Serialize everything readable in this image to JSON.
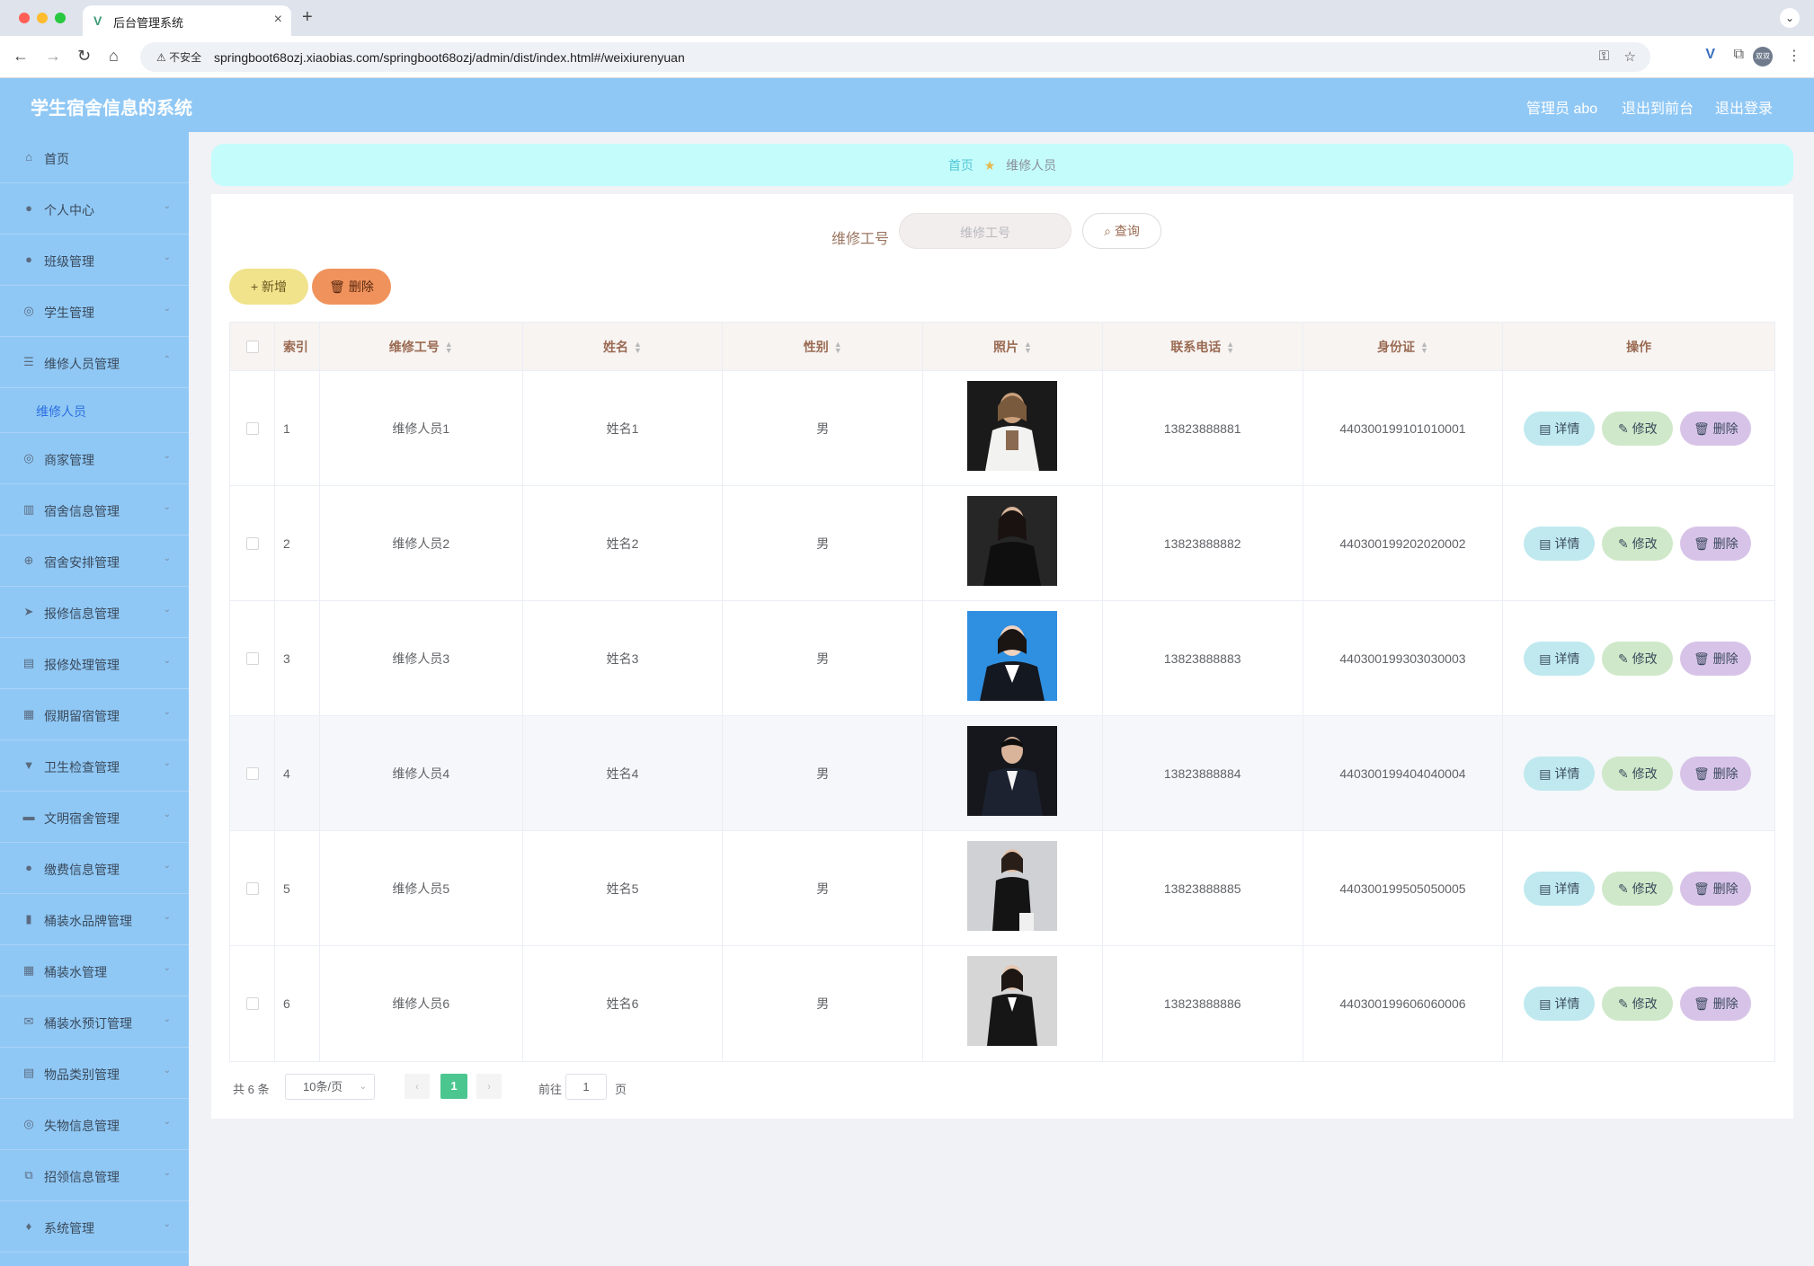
{
  "browser": {
    "tab_title": "后台管理系统",
    "security_label": "不安全",
    "url": "springboot68ozj.xiaobias.com/springboot68ozj/admin/dist/index.html#/weixiurenyuan",
    "profile_label": "双双"
  },
  "header": {
    "title": "学生宿舍信息的系统",
    "admin_label": "管理员 abo",
    "to_front": "退出到前台",
    "logout": "退出登录"
  },
  "sidebar": {
    "items": [
      {
        "label": "首页",
        "icon": "home-icon"
      },
      {
        "label": "个人中心",
        "icon": "user-icon"
      },
      {
        "label": "班级管理",
        "icon": "user-icon"
      },
      {
        "label": "学生管理",
        "icon": "compass-icon"
      },
      {
        "label": "维修人员管理",
        "icon": "sliders-icon"
      },
      {
        "label": "商家管理",
        "icon": "shop-icon"
      },
      {
        "label": "宿舍信息管理",
        "icon": "building-icon"
      },
      {
        "label": "宿舍安排管理",
        "icon": "target-icon"
      },
      {
        "label": "报修信息管理",
        "icon": "send-icon"
      },
      {
        "label": "报修处理管理",
        "icon": "clipboard-icon"
      },
      {
        "label": "假期留宿管理",
        "icon": "grid-icon"
      },
      {
        "label": "卫生检查管理",
        "icon": "brush-icon"
      },
      {
        "label": "文明宿舍管理",
        "icon": "monitor-icon"
      },
      {
        "label": "缴费信息管理",
        "icon": "user-icon"
      },
      {
        "label": "桶装水品牌管理",
        "icon": "chart-icon"
      },
      {
        "label": "桶装水管理",
        "icon": "grid-icon"
      },
      {
        "label": "桶装水预订管理",
        "icon": "mail-icon"
      },
      {
        "label": "物品类别管理",
        "icon": "clipboard-icon"
      },
      {
        "label": "失物信息管理",
        "icon": "compass-icon"
      },
      {
        "label": "招领信息管理",
        "icon": "copy-icon"
      },
      {
        "label": "系统管理",
        "icon": "mic-icon"
      }
    ],
    "sub_item": "维修人员"
  },
  "breadcrumb": {
    "home": "首页",
    "current": "维修人员"
  },
  "search": {
    "label": "维修工号",
    "placeholder": "维修工号",
    "button": "查询"
  },
  "toolbar": {
    "add": "新增",
    "delete": "删除"
  },
  "table": {
    "columns": [
      "索引",
      "维修工号",
      "姓名",
      "性别",
      "照片",
      "联系电话",
      "身份证",
      "操作"
    ],
    "rows": [
      {
        "index": "1",
        "code": "维修人员1",
        "name": "姓名1",
        "gender": "男",
        "phone": "13823888881",
        "idcard": "440300199101010001"
      },
      {
        "index": "2",
        "code": "维修人员2",
        "name": "姓名2",
        "gender": "男",
        "phone": "13823888882",
        "idcard": "440300199202020002"
      },
      {
        "index": "3",
        "code": "维修人员3",
        "name": "姓名3",
        "gender": "男",
        "phone": "13823888883",
        "idcard": "440300199303030003"
      },
      {
        "index": "4",
        "code": "维修人员4",
        "name": "姓名4",
        "gender": "男",
        "phone": "13823888884",
        "idcard": "440300199404040004"
      },
      {
        "index": "5",
        "code": "维修人员5",
        "name": "姓名5",
        "gender": "男",
        "phone": "13823888885",
        "idcard": "440300199505050005"
      },
      {
        "index": "6",
        "code": "维修人员6",
        "name": "姓名6",
        "gender": "男",
        "phone": "13823888886",
        "idcard": "440300199606060006"
      }
    ],
    "actions": {
      "detail": "详情",
      "edit": "修改",
      "delete": "删除"
    }
  },
  "pagination": {
    "total": "共 6 条",
    "page_size": "10条/页",
    "current_page": "1",
    "goto_label": "前往",
    "goto_value": "1",
    "page_suffix": "页"
  }
}
